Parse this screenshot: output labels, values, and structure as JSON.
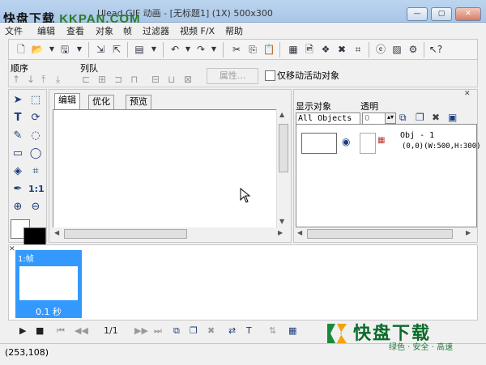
{
  "title_bar": {
    "title": "Ulead GIF 动画 - [无标题1] (1X) 500x300",
    "minimize": "—",
    "maximize": "▢",
    "close": "✕"
  },
  "watermark_top": {
    "brand": "快盘下载",
    "site": "KKPAN.COM"
  },
  "menu": [
    "文件",
    "编辑",
    "查看",
    "对象",
    "帧",
    "过滤器",
    "视频 F/X",
    "帮助"
  ],
  "row2": {
    "order_label": "顺序",
    "queue_label": "列队",
    "properties_button": "属性...",
    "move_active_only": "仅移动活动对象"
  },
  "editor": {
    "tabs": [
      "编辑",
      "优化",
      "预览"
    ],
    "active_tab": "编辑"
  },
  "objects_panel": {
    "display_label": "显示对象",
    "opacity_label": "透明",
    "object_select": "All Objects",
    "opacity_value": "0",
    "object_name": "Obj - 1",
    "object_info": "(0,0)(W:500,H:300)"
  },
  "frames": {
    "frame_label": "1:帧",
    "frame_duration": "0.1 秒"
  },
  "playback": {
    "counter": "1/1"
  },
  "status": {
    "coords": "(253,108)"
  },
  "watermark_bottom": {
    "brand": "快盘下载",
    "tagline": "绿色 · 安全 · 高速"
  },
  "colors": {
    "frame_selected": "#3399ff",
    "foreground": "#000000",
    "background": "#ffffff",
    "brand_green": "#0b6b2a"
  }
}
